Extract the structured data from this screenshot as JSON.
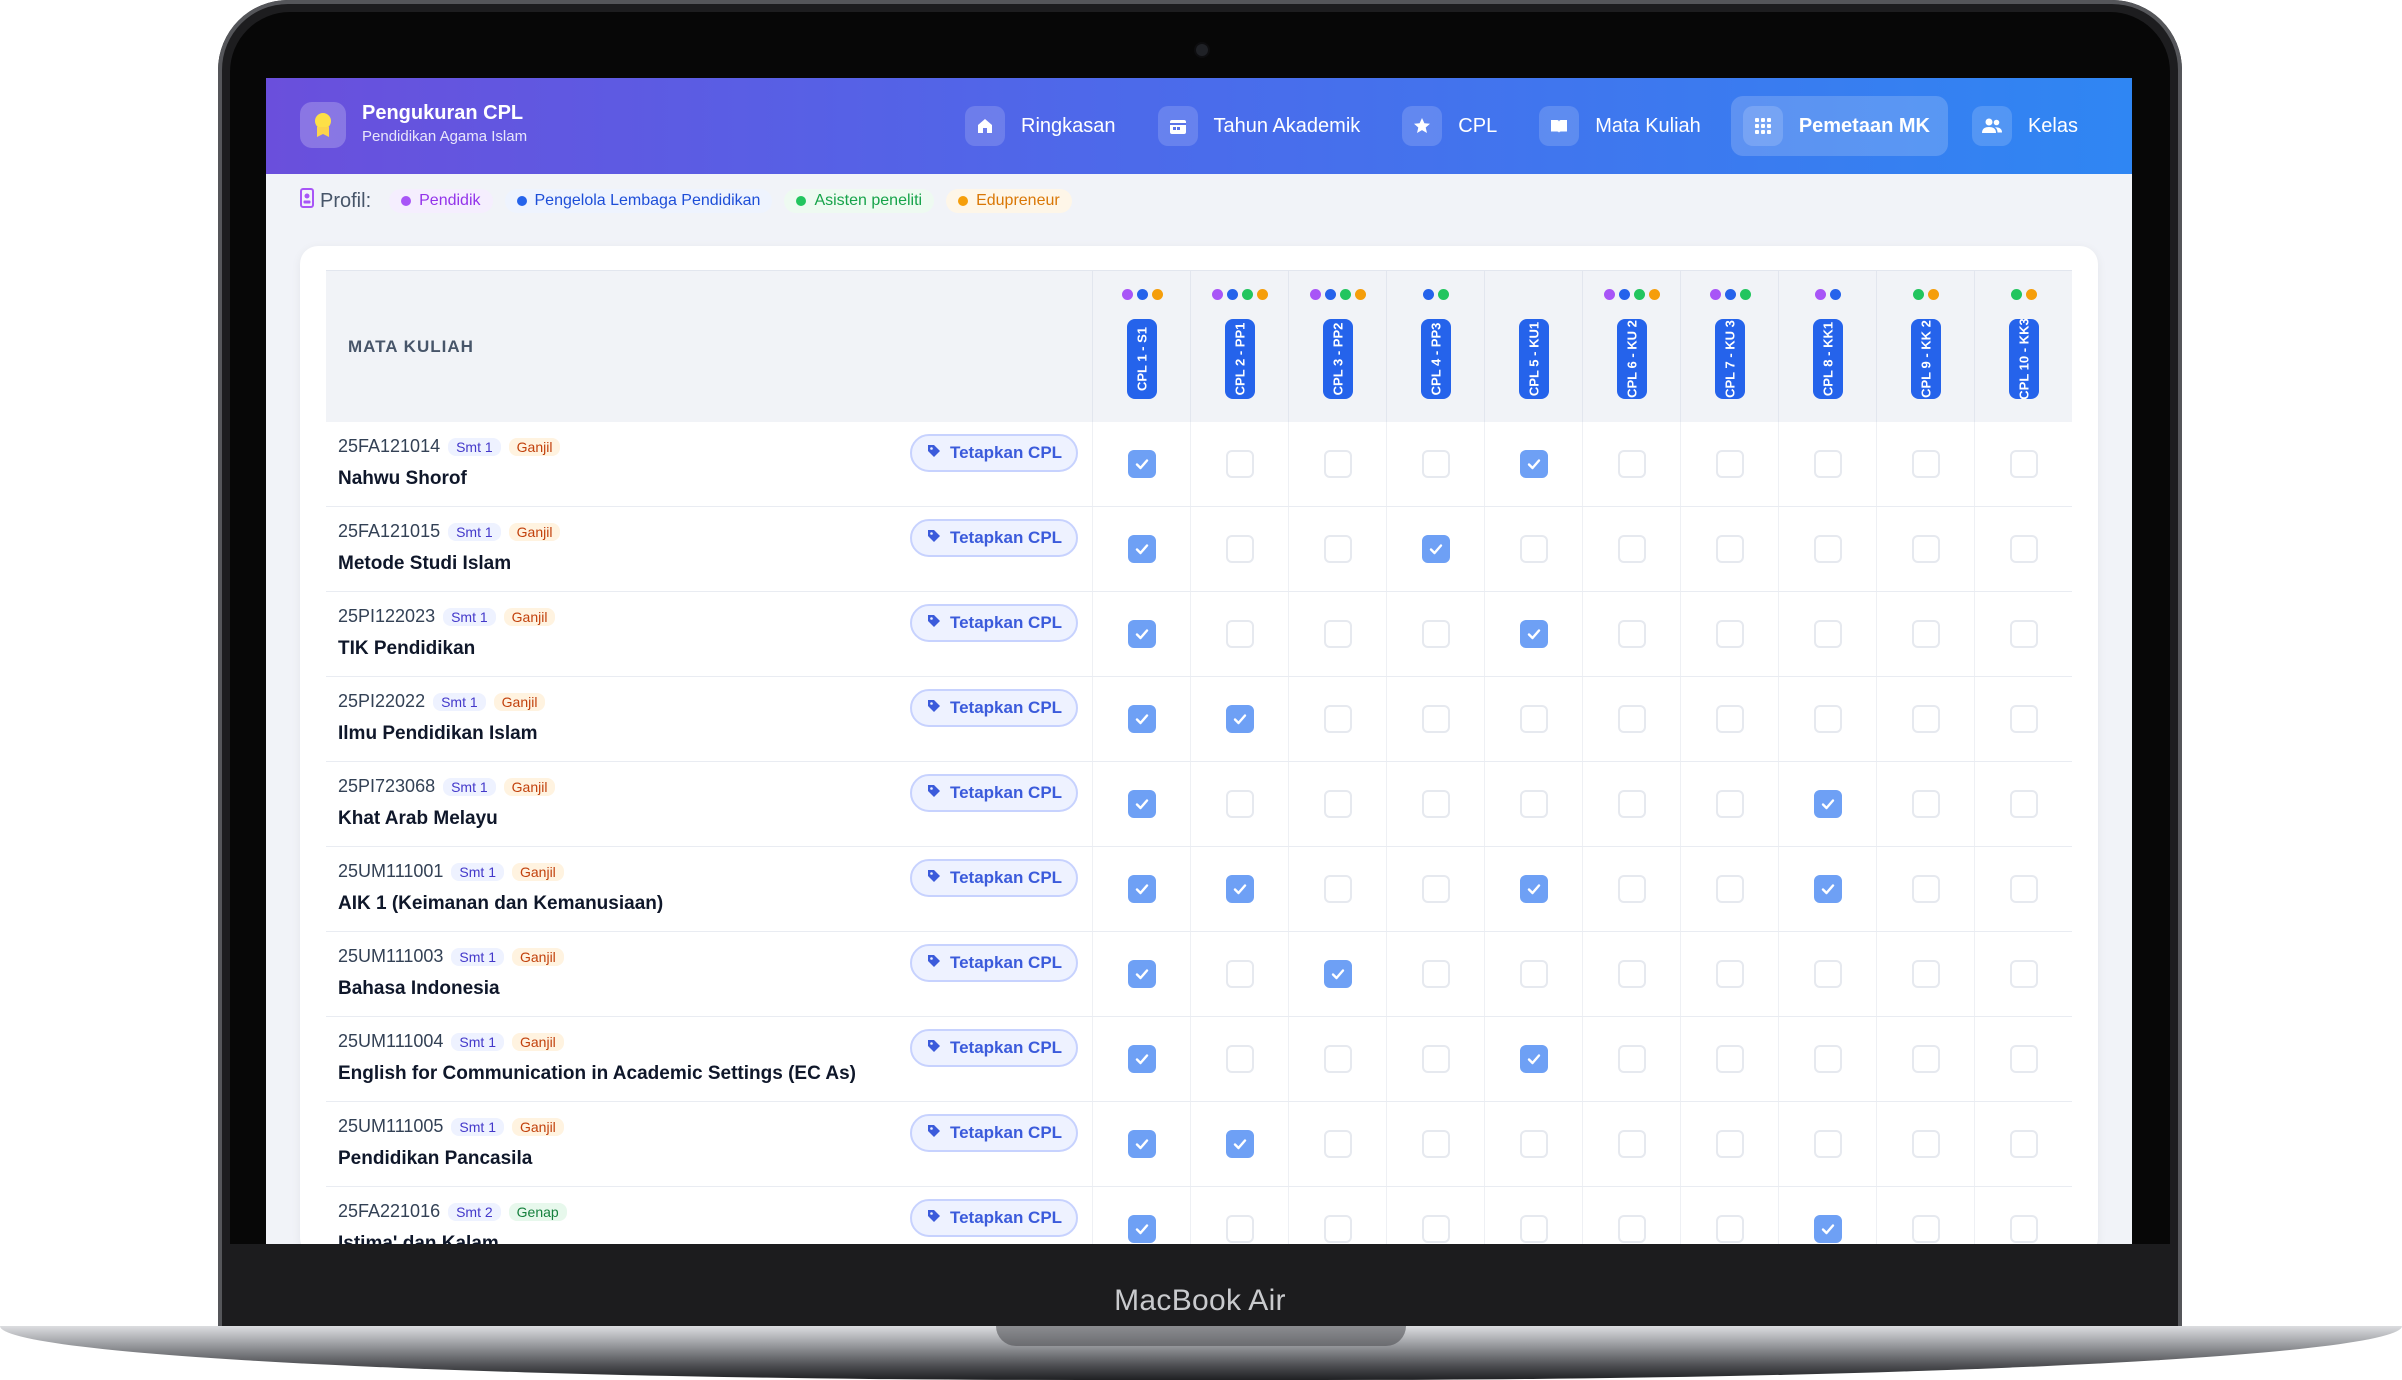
{
  "device": {
    "brand": "MacBook Air"
  },
  "app": {
    "title": "Pengukuran CPL",
    "subtitle": "Pendidikan Agama Islam"
  },
  "nav": [
    {
      "label": "Ringkasan",
      "icon": "home-icon",
      "active": false
    },
    {
      "label": "Tahun Akademik",
      "icon": "calendar-icon",
      "active": false
    },
    {
      "label": "CPL",
      "icon": "star-icon",
      "active": false
    },
    {
      "label": "Mata Kuliah",
      "icon": "book-icon",
      "active": false
    },
    {
      "label": "Pemetaan MK",
      "icon": "grid-icon",
      "active": true
    },
    {
      "label": "Kelas",
      "icon": "users-icon",
      "active": false
    }
  ],
  "profiles": {
    "label": "Profil:",
    "items": [
      {
        "label": "Pendidik",
        "color": "#a855f7",
        "bg": "#f5eefe",
        "fg": "#9333ea"
      },
      {
        "label": "Pengelola Lembaga Pendidikan",
        "color": "#2563eb",
        "bg": "#eef3fe",
        "fg": "#1d4ed8"
      },
      {
        "label": "Asisten peneliti",
        "color": "#22c55e",
        "bg": "#eefaf1",
        "fg": "#16a34a"
      },
      {
        "label": "Edupreneur",
        "color": "#f59e0b",
        "bg": "#fef6e8",
        "fg": "#d97706"
      }
    ]
  },
  "table": {
    "course_header": "MATA KULIAH",
    "assign_label": "Tetapkan CPL",
    "cpl": [
      {
        "label": "CPL 1 - S1",
        "dots": [
          "#a855f7",
          "#2563eb",
          "#f59e0b"
        ]
      },
      {
        "label": "CPL 2 - PP1",
        "dots": [
          "#a855f7",
          "#2563eb",
          "#22c55e",
          "#f59e0b"
        ]
      },
      {
        "label": "CPL 3 - PP2",
        "dots": [
          "#a855f7",
          "#2563eb",
          "#22c55e",
          "#f59e0b"
        ]
      },
      {
        "label": "CPL 4 - PP3",
        "dots": [
          "#2563eb",
          "#22c55e"
        ]
      },
      {
        "label": "CPL 5 - KU1",
        "dots": []
      },
      {
        "label": "CPL 6 - KU 2",
        "dots": [
          "#a855f7",
          "#2563eb",
          "#22c55e",
          "#f59e0b"
        ]
      },
      {
        "label": "CPL 7 - KU 3",
        "dots": [
          "#a855f7",
          "#2563eb",
          "#22c55e"
        ]
      },
      {
        "label": "CPL 8 - KK1",
        "dots": [
          "#a855f7",
          "#2563eb"
        ]
      },
      {
        "label": "CPL 9 - KK 2",
        "dots": [
          "#22c55e",
          "#f59e0b"
        ]
      },
      {
        "label": "CPL 10 - KK3",
        "dots": [
          "#22c55e",
          "#f59e0b"
        ]
      }
    ],
    "rows": [
      {
        "code": "25FA121014",
        "smt": "Smt 1",
        "term": "Ganjil",
        "name": "Nahwu Shorof",
        "checks": [
          1,
          0,
          0,
          0,
          1,
          0,
          0,
          0,
          0,
          0
        ]
      },
      {
        "code": "25FA121015",
        "smt": "Smt 1",
        "term": "Ganjil",
        "name": "Metode Studi Islam",
        "checks": [
          1,
          0,
          0,
          1,
          0,
          0,
          0,
          0,
          0,
          0
        ]
      },
      {
        "code": "25PI122023",
        "smt": "Smt 1",
        "term": "Ganjil",
        "name": "TIK Pendidikan",
        "checks": [
          1,
          0,
          0,
          0,
          1,
          0,
          0,
          0,
          0,
          0
        ]
      },
      {
        "code": "25PI22022",
        "smt": "Smt 1",
        "term": "Ganjil",
        "name": "Ilmu Pendidikan Islam",
        "checks": [
          1,
          1,
          0,
          0,
          0,
          0,
          0,
          0,
          0,
          0
        ]
      },
      {
        "code": "25PI723068",
        "smt": "Smt 1",
        "term": "Ganjil",
        "name": "Khat Arab Melayu",
        "checks": [
          1,
          0,
          0,
          0,
          0,
          0,
          0,
          1,
          0,
          0
        ]
      },
      {
        "code": "25UM111001",
        "smt": "Smt 1",
        "term": "Ganjil",
        "name": "AIK 1 (Keimanan dan Kemanusiaan)",
        "checks": [
          1,
          1,
          0,
          0,
          1,
          0,
          0,
          1,
          0,
          0
        ]
      },
      {
        "code": "25UM111003",
        "smt": "Smt 1",
        "term": "Ganjil",
        "name": "Bahasa Indonesia",
        "checks": [
          1,
          0,
          1,
          0,
          0,
          0,
          0,
          0,
          0,
          0
        ]
      },
      {
        "code": "25UM111004",
        "smt": "Smt 1",
        "term": "Ganjil",
        "name": "English for Communication in Academic Settings (EC As)",
        "checks": [
          1,
          0,
          0,
          0,
          1,
          0,
          0,
          0,
          0,
          0
        ]
      },
      {
        "code": "25UM111005",
        "smt": "Smt 1",
        "term": "Ganjil",
        "name": "Pendidikan Pancasila",
        "checks": [
          1,
          1,
          0,
          0,
          0,
          0,
          0,
          0,
          0,
          0
        ]
      },
      {
        "code": "25FA221016",
        "smt": "Smt 2",
        "term": "Genap",
        "name": "Istima' dan Kalam",
        "checks": [
          1,
          0,
          0,
          0,
          0,
          0,
          0,
          1,
          0,
          0
        ]
      }
    ]
  }
}
